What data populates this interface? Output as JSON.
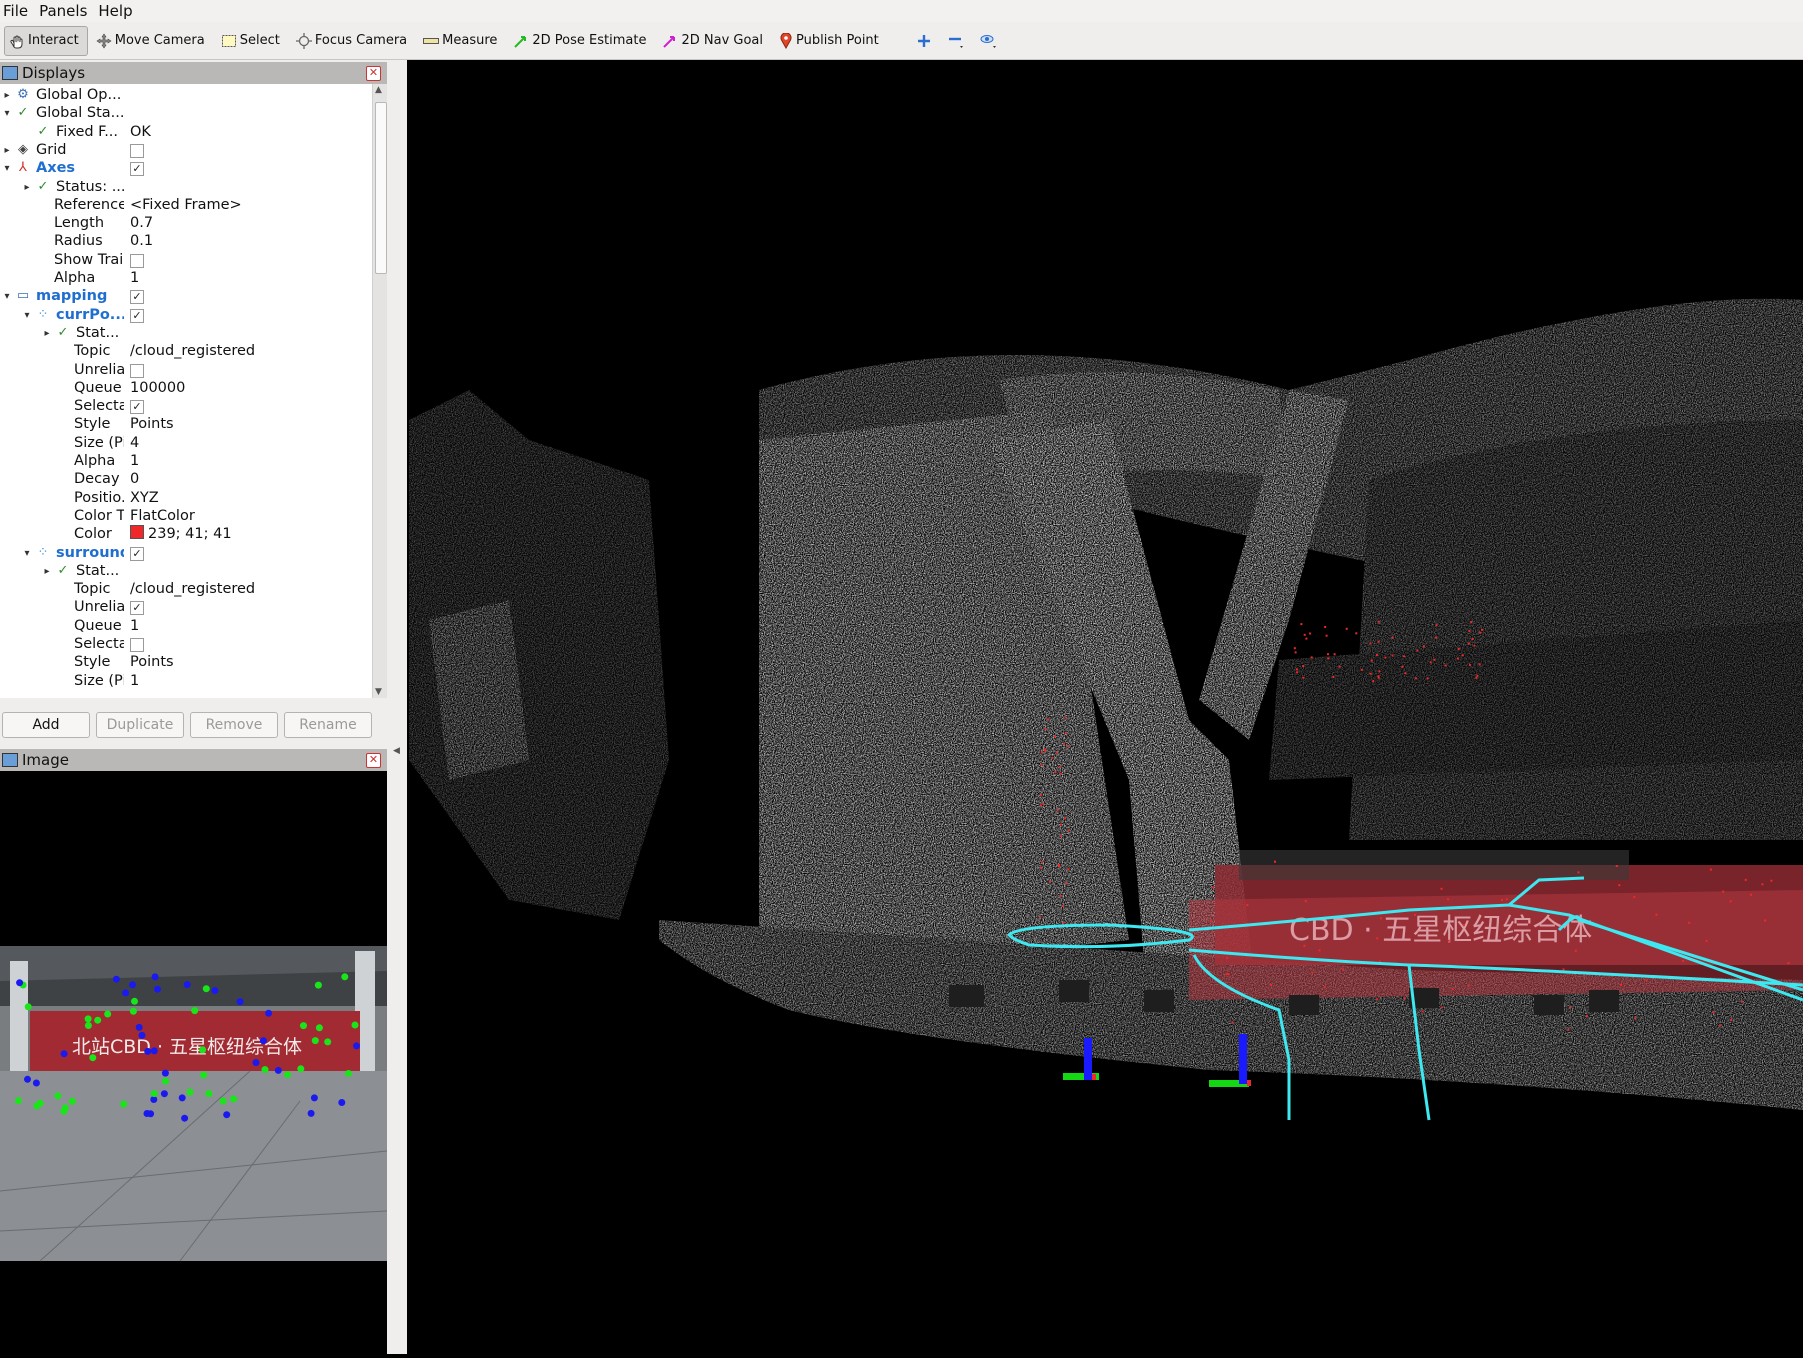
{
  "menubar": {
    "items": [
      "File",
      "Panels",
      "Help"
    ]
  },
  "toolbar": {
    "tools": [
      "Interact",
      "Move Camera",
      "Select",
      "Focus Camera",
      "Measure",
      "2D Pose Estimate",
      "2D Nav Goal",
      "Publish Point"
    ],
    "active_tool": "Interact"
  },
  "displays_panel": {
    "title": "Displays",
    "rows": [
      {
        "label": "Global Op...",
        "value": ""
      },
      {
        "label": "Global Sta...",
        "value": ""
      },
      {
        "label": "Fixed F...",
        "value": "OK"
      },
      {
        "label": "Grid",
        "checked": false
      },
      {
        "label": "Axes",
        "checked": true
      },
      {
        "label": "Status: ...",
        "value": ""
      },
      {
        "label": "Reference...",
        "value": "<Fixed Frame>"
      },
      {
        "label": "Length",
        "value": "0.7"
      },
      {
        "label": "Radius",
        "value": "0.1"
      },
      {
        "label": "Show Trail",
        "checked": false
      },
      {
        "label": "Alpha",
        "value": "1"
      },
      {
        "label": "mapping",
        "checked": true
      },
      {
        "label": "currPo...",
        "checked": true
      },
      {
        "label": "Stat...",
        "value": ""
      },
      {
        "label": "Topic",
        "value": "/cloud_registered"
      },
      {
        "label": "Unrelia...",
        "checked": false
      },
      {
        "label": "Queue ...",
        "value": "100000"
      },
      {
        "label": "Selecta...",
        "checked": true
      },
      {
        "label": "Style",
        "value": "Points"
      },
      {
        "label": "Size (Pi...",
        "value": "4"
      },
      {
        "label": "Alpha",
        "value": "1"
      },
      {
        "label": "Decay T...",
        "value": "0"
      },
      {
        "label": "Positio...",
        "value": "XYZ"
      },
      {
        "label": "Color T...",
        "value": "FlatColor"
      },
      {
        "label": "Color",
        "value": "239; 41; 41",
        "swatch": "#ef2929"
      },
      {
        "label": "surround",
        "checked": true
      },
      {
        "label": "Stat...",
        "value": ""
      },
      {
        "label": "Topic",
        "value": "/cloud_registered"
      },
      {
        "label": "Unrelia...",
        "checked": true
      },
      {
        "label": "Queue ...",
        "value": "1"
      },
      {
        "label": "Selecta...",
        "checked": false
      },
      {
        "label": "Style",
        "value": "Points"
      },
      {
        "label": "Size (Pi...",
        "value": "1"
      }
    ],
    "buttons": [
      "Add",
      "Duplicate",
      "Remove",
      "Rename"
    ]
  },
  "image_panel": {
    "title": "Image",
    "banner_text": "北站CBD · 五星枢纽综合体"
  },
  "viewport": {
    "banner_text": "CBD · 五星枢纽综合体",
    "colors": {
      "trajectory": "#3de8f0",
      "current_points": "#ef2929",
      "axis_z": "#1a1aff",
      "axis_y": "#13d813"
    }
  }
}
